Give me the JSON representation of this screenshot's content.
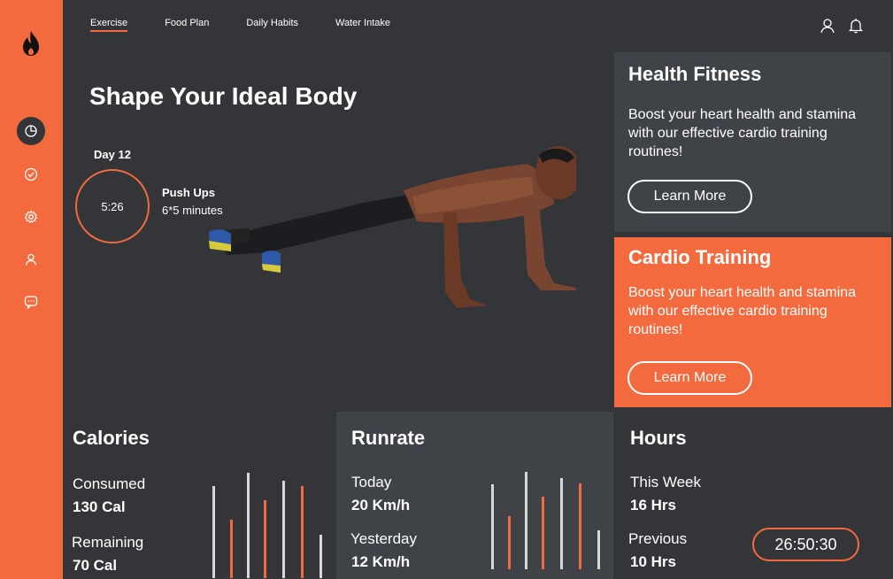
{
  "nav": {
    "items": [
      "Exercise",
      "Food Plan",
      "Daily Habits",
      "Water Intake"
    ],
    "active": "Exercise"
  },
  "sidebar": {
    "icons": [
      "flame-icon",
      "pie-chart-icon",
      "check-circle-icon",
      "gear-icon",
      "user-icon",
      "chat-icon"
    ]
  },
  "hero": {
    "title": "Shape Your Ideal Body",
    "day": "Day 12",
    "timer": "5:26",
    "exercise": "Push Ups",
    "detail": "6*5 minutes"
  },
  "cards": {
    "health": {
      "title": "Health Fitness",
      "text": "Boost your heart health and stamina with our effective cardio training routines!",
      "button": "Learn More"
    },
    "cardio": {
      "title": "Cardio Training",
      "text": "Boost your heart health and stamina with our effective cardio training routines!",
      "button": "Learn More"
    }
  },
  "calories": {
    "title": "Calories",
    "consumed_label": "Consumed",
    "consumed_value": "130 Cal",
    "remaining_label": "Remaining",
    "remaining_value": "70 Cal"
  },
  "runrate": {
    "title": "Runrate",
    "today_label": "Today",
    "today_value": "20 Km/h",
    "yesterday_label": "Yesterday",
    "yesterday_value": "12 Km/h"
  },
  "hours": {
    "title": "Hours",
    "week_label": "This Week",
    "week_value": "16 Hrs",
    "prev_label": "Previous",
    "prev_value": "10 Hrs",
    "timer": "26:50:30"
  },
  "colors": {
    "accent": "#f26a3d",
    "background": "#333538",
    "panel": "#3f4246"
  }
}
